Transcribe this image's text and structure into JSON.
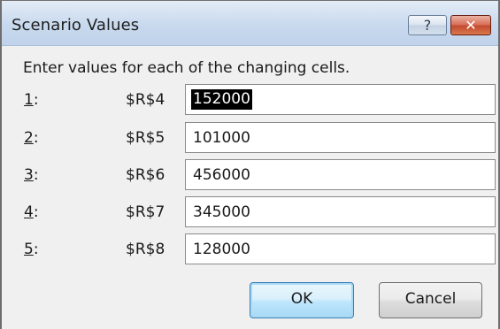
{
  "window": {
    "title": "Scenario Values",
    "help_label": "?",
    "close_label": "✕"
  },
  "instruction": "Enter values for each of the changing cells.",
  "rows": [
    {
      "num_key": "1",
      "num_suffix": ":",
      "ref": "$R$4",
      "value": "152000",
      "selected": true
    },
    {
      "num_key": "2",
      "num_suffix": ":",
      "ref": "$R$5",
      "value": "101000",
      "selected": false
    },
    {
      "num_key": "3",
      "num_suffix": ":",
      "ref": "$R$6",
      "value": "456000",
      "selected": false
    },
    {
      "num_key": "4",
      "num_suffix": ":",
      "ref": "$R$7",
      "value": "345000",
      "selected": false
    },
    {
      "num_key": "5",
      "num_suffix": ":",
      "ref": "$R$8",
      "value": "128000",
      "selected": false
    }
  ],
  "buttons": {
    "ok_label": "OK",
    "cancel_label": "Cancel"
  }
}
